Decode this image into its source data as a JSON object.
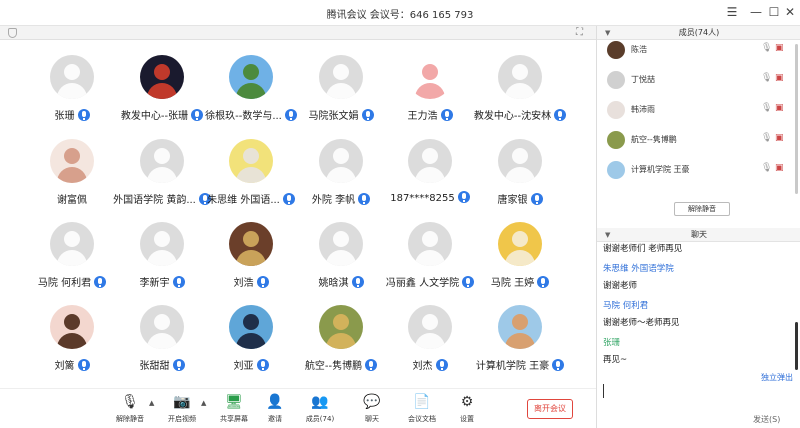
{
  "window": {
    "title": "腾讯会议 会议号：646 165 793",
    "controls": [
      "menu-lines",
      "minimize",
      "maximize",
      "close"
    ]
  },
  "participants": [
    {
      "name": "张珊",
      "mic": true,
      "photo": false
    },
    {
      "name": "教发中心--张珊",
      "mic": true,
      "photo": true,
      "colors": [
        "#1a1a2e",
        "#c0392b"
      ]
    },
    {
      "name": "徐根玖--数学与...",
      "mic": true,
      "photo": true,
      "colors": [
        "#6fb1e6",
        "#4c8a3e"
      ]
    },
    {
      "name": "马院张文娟",
      "mic": true,
      "photo": false
    },
    {
      "name": "王力浩",
      "mic": true,
      "photo": true,
      "colors": [
        "#ffffff",
        "#f2a8a8"
      ]
    },
    {
      "name": "教发中心--沈安林",
      "mic": true,
      "photo": false
    },
    {
      "name": "谢富佩",
      "mic": false,
      "photo": true,
      "colors": [
        "#f4e6df",
        "#d7a08c"
      ]
    },
    {
      "name": "外国语学院 黄韵...",
      "mic": true,
      "photo": false
    },
    {
      "name": "朱思维 外国语...",
      "mic": true,
      "photo": true,
      "colors": [
        "#f2e27a",
        "#e8e3d6"
      ]
    },
    {
      "name": "外院 李帆",
      "mic": true,
      "photo": false
    },
    {
      "name": "187****8255",
      "mic": true,
      "photo": false
    },
    {
      "name": "唐家银",
      "mic": true,
      "photo": false
    },
    {
      "name": "马院 何利君",
      "mic": true,
      "photo": false
    },
    {
      "name": "李新宇",
      "mic": true,
      "photo": false
    },
    {
      "name": "刘浩",
      "mic": true,
      "photo": true,
      "colors": [
        "#6b3f2a",
        "#c9a25a"
      ]
    },
    {
      "name": "姚晗淇",
      "mic": true,
      "photo": false
    },
    {
      "name": "冯丽鑫 人文学院",
      "mic": true,
      "photo": false
    },
    {
      "name": "马院 王婷",
      "mic": true,
      "photo": true,
      "colors": [
        "#f0c64a",
        "#f5e9c8"
      ]
    },
    {
      "name": "刘篱",
      "mic": true,
      "photo": true,
      "colors": [
        "#f3d7cf",
        "#5b3a2a"
      ]
    },
    {
      "name": "张甜甜",
      "mic": true,
      "photo": false
    },
    {
      "name": "刘亚",
      "mic": true,
      "photo": true,
      "colors": [
        "#5fa6d8",
        "#1f2f4a"
      ]
    },
    {
      "name": "航空--隽博鹏",
      "mic": true,
      "photo": true,
      "colors": [
        "#8a9a4c",
        "#d2b25b"
      ]
    },
    {
      "name": "刘杰",
      "mic": true,
      "photo": false
    },
    {
      "name": "计算机学院 王豪",
      "mic": true,
      "photo": true,
      "colors": [
        "#9ec9e8",
        "#d8a070"
      ]
    }
  ],
  "toolbar": {
    "unmute_label": "解除静音",
    "video_label": "开启视频",
    "share_label": "共享屏幕",
    "invite_label": "邀请",
    "members_label": "成员(74)",
    "chat_label": "聊天",
    "docs_label": "会议文档",
    "settings_label": "设置",
    "leave_label": "离开会议"
  },
  "members_panel": {
    "title": "成员(74人)",
    "items": [
      {
        "name": "陈浩",
        "color": "#5a3d2b"
      },
      {
        "name": "丁悦喆",
        "color": "#d0d0d0"
      },
      {
        "name": "韩沛雨",
        "color": "#e8e0dc"
      },
      {
        "name": "航空--隽博鹏",
        "color": "#8a9a4c"
      },
      {
        "name": "计算机学院 王豪",
        "color": "#9ec9e8"
      }
    ],
    "unmute_all_label": "解除静音"
  },
  "chat_panel": {
    "title": "聊天",
    "messages": [
      {
        "sender": "",
        "text": "谢谢老师们 老师再见"
      },
      {
        "sender": "朱思维 外国语学院",
        "text": "谢谢老师"
      },
      {
        "sender": "马院 何利君",
        "text": "谢谢老师～老师再见"
      },
      {
        "sender": "张珊",
        "text": "再见~"
      }
    ],
    "detach_label": "独立弹出",
    "send_label": "发送(S)"
  }
}
